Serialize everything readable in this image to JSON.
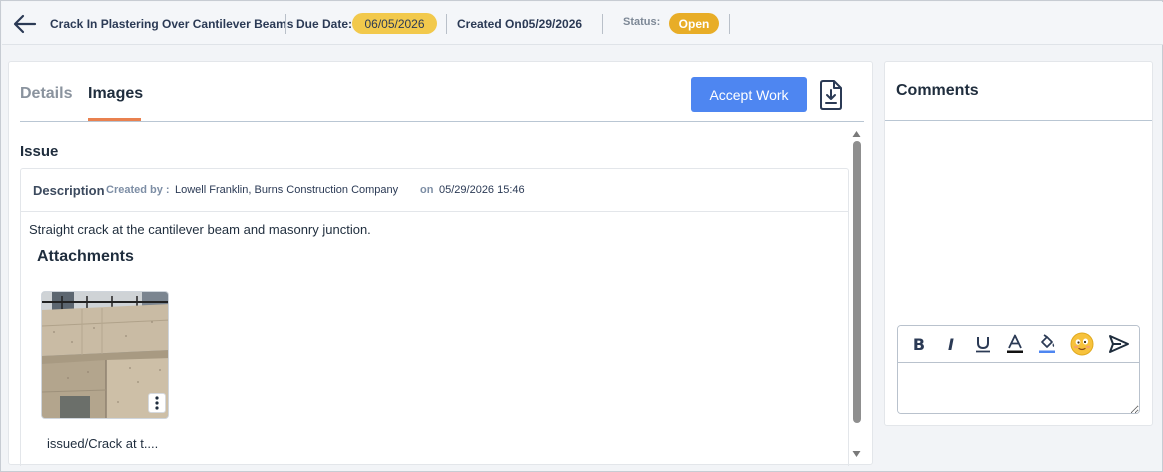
{
  "header": {
    "title": "Crack In Plastering Over Cantilever Beams",
    "due_label": "Due Date:",
    "due_value": "06/05/2026",
    "created_label": "Created On:",
    "created_value": "05/29/2026",
    "status_label": "Status:",
    "status_value": "Open"
  },
  "tabs": [
    {
      "label": "Details",
      "active": false
    },
    {
      "label": "Images",
      "active": true
    }
  ],
  "actions": {
    "accept_label": "Accept Work"
  },
  "issue": {
    "heading": "Issue",
    "description_title": "Description",
    "created_by_label": "Created by :",
    "created_by_value": "Lowell Franklin, Burns Construction Company",
    "on_label": "on",
    "created_date": "05/29/2026 15:46",
    "description_text": "Straight crack at the cantilever beam and masonry junction.",
    "attachments_heading": "Attachments",
    "attachments": [
      {
        "caption": "issued/Crack at t...."
      }
    ]
  },
  "comments": {
    "title": "Comments",
    "toolbar": [
      "bold-icon",
      "italic-icon",
      "underline-icon",
      "font-color-icon",
      "fill-color-icon",
      "emoji-icon",
      "send-icon"
    ],
    "input_value": ""
  },
  "colors": {
    "accent": "#4e86f1",
    "tab_underline": "#e9814f",
    "due_pill": "#f2c94c",
    "status_pill": "#e8ad27"
  }
}
